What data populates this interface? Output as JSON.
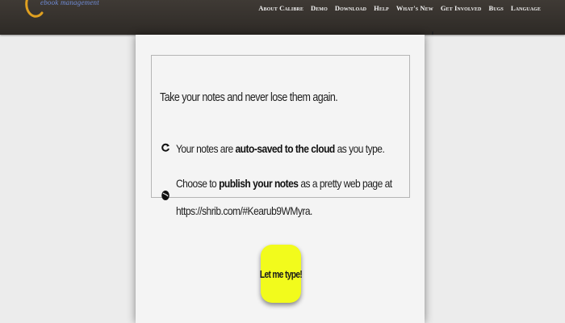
{
  "header": {
    "logo_subtitle": "ebook management",
    "nav": [
      "About Calibre",
      "Demo",
      "Download",
      "Help",
      "What's New",
      "Get Involved",
      "Bugs",
      "Language"
    ]
  },
  "notes": {
    "intro": "Take your notes and never lose them again.",
    "feature1": {
      "icon": "sync-icon",
      "before": "Your notes are ",
      "bold": "auto-saved to the cloud",
      "after": " as you type."
    },
    "feature2": {
      "icon": "globe-icon",
      "before": "Choose to ",
      "bold": "publish your notes",
      "after": " as a pretty web page at",
      "url": "https://shrib.com/#Kearub9WMyra."
    },
    "cta_label": "Let me type!"
  },
  "colors": {
    "header_bg": "#352f2a",
    "cta_bg": "#f2fb1c",
    "logo_accent": "#e0a020"
  }
}
